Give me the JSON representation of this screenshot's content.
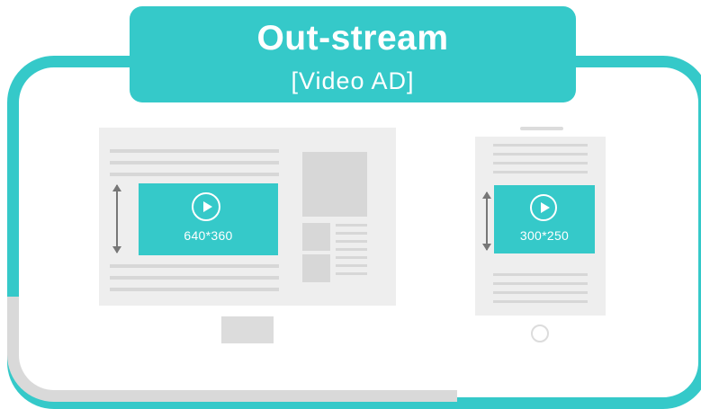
{
  "title": {
    "main": "Out-stream",
    "sub": "[Video AD]"
  },
  "desktop": {
    "ad_size": "640*360"
  },
  "mobile": {
    "ad_size": "300*250"
  },
  "colors": {
    "accent": "#35c9c9",
    "placeholder": "#d7d7d7",
    "screen": "#eeeeee",
    "frame_gray": "#d9d9d9"
  },
  "icons": [
    "play-icon",
    "vertical-double-arrow-icon"
  ]
}
